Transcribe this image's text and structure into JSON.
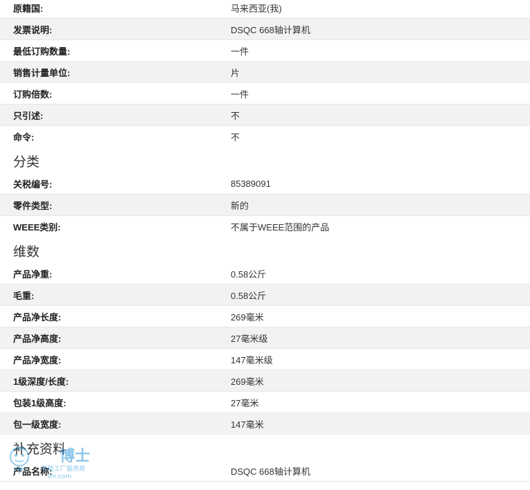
{
  "sections": [
    {
      "heading": "",
      "rows": [
        {
          "label": "原籍国:",
          "value": "马来西亚(我)"
        },
        {
          "label": "发票说明:",
          "value": "DSQC 668轴计算机"
        },
        {
          "label": "最低订购数量:",
          "value": "一件"
        },
        {
          "label": "销售计量单位:",
          "value": "片"
        },
        {
          "label": "订购倍数:",
          "value": "一件"
        },
        {
          "label": "只引述:",
          "value": "不"
        },
        {
          "label": "命令:",
          "value": "不"
        }
      ]
    },
    {
      "heading": "分类",
      "rows": [
        {
          "label": "关税编号:",
          "value": "85389091"
        },
        {
          "label": "零件类型:",
          "value": "新的"
        },
        {
          "label": "WEEE类别:",
          "value": "不属于WEEE范围的产品"
        }
      ]
    },
    {
      "heading": "维数",
      "rows": [
        {
          "label": "产品净重:",
          "value": "0.58公斤"
        },
        {
          "label": "毛重:",
          "value": "0.58公斤"
        },
        {
          "label": "产品净长度:",
          "value": "269毫米"
        },
        {
          "label": "产品净高度:",
          "value": "27毫米级"
        },
        {
          "label": "产品净宽度:",
          "value": "147毫米级"
        },
        {
          "label": "1级深度/长度:",
          "value": "269毫米"
        },
        {
          "label": "包装1级高度:",
          "value": "27毫米"
        },
        {
          "label": "包一级宽度:",
          "value": "147毫米"
        }
      ]
    },
    {
      "heading": "补充资料",
      "rows": [
        {
          "label": "产品名称:",
          "value": "DSQC 668轴计算机"
        }
      ]
    }
  ],
  "watermark": {
    "brand": "博士",
    "tagline": "智能工厂服务商",
    "url_fragment": "shi.com"
  },
  "colors": {
    "row_alt_bg": "#f2f2f2",
    "divider": "#e6e6e6",
    "watermark_blue": "#1a8fd6"
  }
}
